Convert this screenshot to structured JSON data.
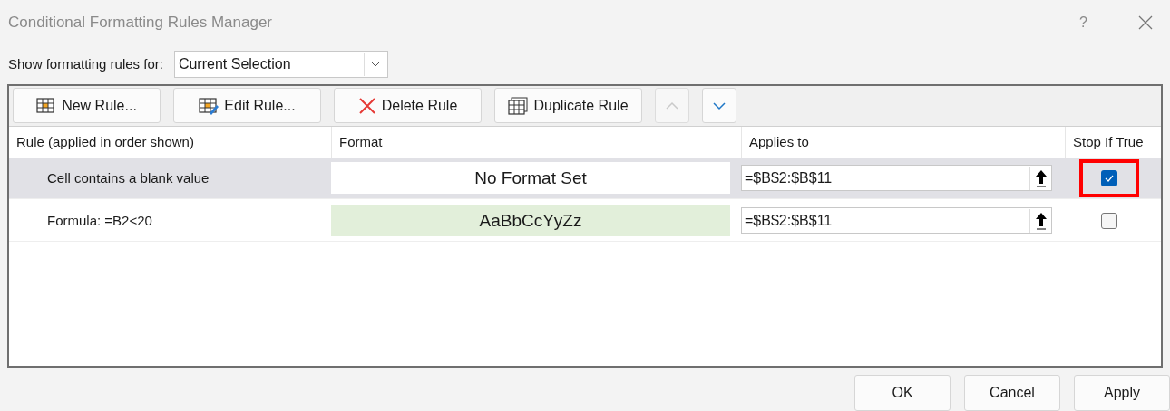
{
  "window": {
    "title": "Conditional Formatting Rules Manager",
    "help": "?"
  },
  "show_rules_for": {
    "label": "Show formatting rules for:",
    "value": "Current Selection"
  },
  "toolbar": [
    {
      "kind": "new",
      "label": "New Rule..."
    },
    {
      "kind": "edit",
      "label": "Edit Rule..."
    },
    {
      "kind": "delete",
      "label": "Delete Rule"
    },
    {
      "kind": "duplicate",
      "label": "Duplicate Rule"
    },
    {
      "kind": "up",
      "disabled": true
    },
    {
      "kind": "down",
      "disabled": false
    }
  ],
  "table": {
    "columns": [
      "Rule (applied in order shown)",
      "Format",
      "Applies to",
      "Stop If True"
    ],
    "rows": [
      {
        "rule": "Cell contains a blank value",
        "format": "No Format Set",
        "color": "#ffffff",
        "applies_to": "=$B$2:$B$11",
        "stop_if_true": true,
        "selected": true,
        "highlighted": true
      },
      {
        "rule": "Formula: =B2<20",
        "format": "AaBbCcYyZz",
        "color": "#e2efda",
        "applies_to": "=$B$2:$B$11",
        "stop_if_true": false,
        "selected": false,
        "highlighted": false
      }
    ]
  },
  "buttons": [
    "OK",
    "Cancel",
    "Apply"
  ]
}
